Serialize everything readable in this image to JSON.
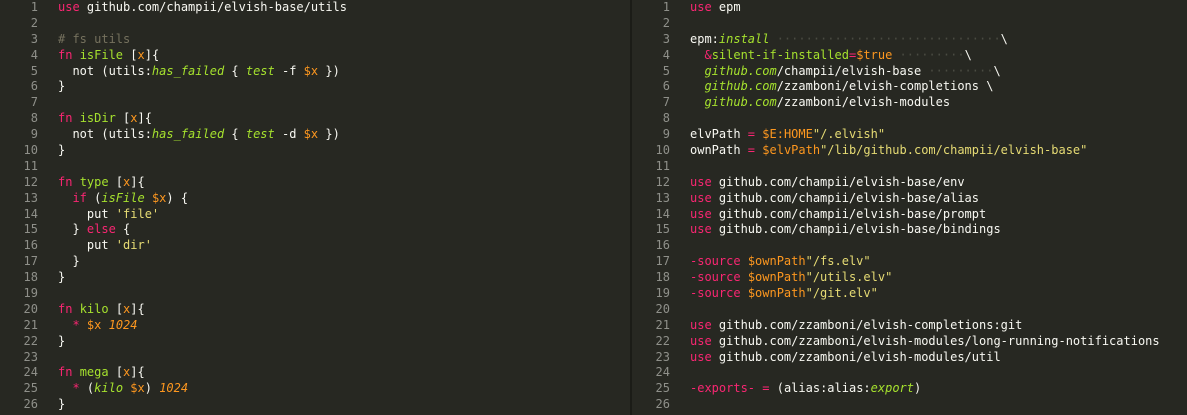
{
  "colors": {
    "background": "#272822",
    "keyword": "#f92672",
    "function": "#a6e22e",
    "parameter": "#fd971f",
    "string": "#e6db74",
    "comment": "#75715e",
    "number": "#ae81ff",
    "plain": "#f8f8f2",
    "line_number": "#8f908a"
  },
  "left_pane": {
    "lines": [
      {
        "n": "1",
        "segs": [
          [
            "kw",
            "use"
          ],
          [
            "pl",
            " github.com/champii/elvish-base/utils"
          ]
        ]
      },
      {
        "n": "2",
        "segs": []
      },
      {
        "n": "3",
        "segs": [
          [
            "cm",
            "# fs utils"
          ]
        ]
      },
      {
        "n": "4",
        "segs": [
          [
            "kw",
            "fn"
          ],
          [
            "pl",
            " "
          ],
          [
            "fn",
            "isFile"
          ],
          [
            "pl",
            " ["
          ],
          [
            "or",
            "x"
          ],
          [
            "pl",
            "]{"
          ]
        ]
      },
      {
        "n": "5",
        "segs": [
          [
            "pl",
            "  not (utils:"
          ],
          [
            "fn ital",
            "has_failed"
          ],
          [
            "pl",
            " { "
          ],
          [
            "fn ital",
            "test"
          ],
          [
            "pl",
            " -f "
          ],
          [
            "or",
            "$x"
          ],
          [
            "pl",
            " })"
          ]
        ]
      },
      {
        "n": "6",
        "segs": [
          [
            "pl",
            "}"
          ]
        ]
      },
      {
        "n": "7",
        "segs": []
      },
      {
        "n": "8",
        "segs": [
          [
            "kw",
            "fn"
          ],
          [
            "pl",
            " "
          ],
          [
            "fn",
            "isDir"
          ],
          [
            "pl",
            " ["
          ],
          [
            "or",
            "x"
          ],
          [
            "pl",
            "]{"
          ]
        ]
      },
      {
        "n": "9",
        "segs": [
          [
            "pl",
            "  not (utils:"
          ],
          [
            "fn ital",
            "has_failed"
          ],
          [
            "pl",
            " { "
          ],
          [
            "fn ital",
            "test"
          ],
          [
            "pl",
            " -d "
          ],
          [
            "or",
            "$x"
          ],
          [
            "pl",
            " })"
          ]
        ]
      },
      {
        "n": "10",
        "segs": [
          [
            "pl",
            "}"
          ]
        ]
      },
      {
        "n": "11",
        "segs": []
      },
      {
        "n": "12",
        "segs": [
          [
            "kw",
            "fn"
          ],
          [
            "pl",
            " "
          ],
          [
            "fn",
            "type"
          ],
          [
            "pl",
            " ["
          ],
          [
            "or",
            "x"
          ],
          [
            "pl",
            "]{"
          ]
        ]
      },
      {
        "n": "13",
        "segs": [
          [
            "pl",
            "  "
          ],
          [
            "kw",
            "if"
          ],
          [
            "pl",
            " ("
          ],
          [
            "fn ital",
            "isFile"
          ],
          [
            "pl",
            " "
          ],
          [
            "or",
            "$x"
          ],
          [
            "pl",
            ") {"
          ]
        ]
      },
      {
        "n": "14",
        "segs": [
          [
            "pl",
            "    put "
          ],
          [
            "st",
            "'file'"
          ]
        ]
      },
      {
        "n": "15",
        "segs": [
          [
            "pl",
            "  } "
          ],
          [
            "kw",
            "else"
          ],
          [
            "pl",
            " {"
          ]
        ]
      },
      {
        "n": "16",
        "segs": [
          [
            "pl",
            "    put "
          ],
          [
            "st",
            "'dir'"
          ]
        ]
      },
      {
        "n": "17",
        "segs": [
          [
            "pl",
            "  }"
          ]
        ]
      },
      {
        "n": "18",
        "segs": [
          [
            "pl",
            "}"
          ]
        ]
      },
      {
        "n": "19",
        "segs": []
      },
      {
        "n": "20",
        "segs": [
          [
            "kw",
            "fn"
          ],
          [
            "pl",
            " "
          ],
          [
            "fn",
            "kilo"
          ],
          [
            "pl",
            " ["
          ],
          [
            "or",
            "x"
          ],
          [
            "pl",
            "]{"
          ]
        ]
      },
      {
        "n": "21",
        "segs": [
          [
            "pl",
            "  "
          ],
          [
            "kw",
            "*"
          ],
          [
            "pl",
            " "
          ],
          [
            "or",
            "$x"
          ],
          [
            "pl",
            " "
          ],
          [
            "or ital",
            "1024"
          ]
        ]
      },
      {
        "n": "22",
        "segs": [
          [
            "pl",
            "}"
          ]
        ]
      },
      {
        "n": "23",
        "segs": []
      },
      {
        "n": "24",
        "segs": [
          [
            "kw",
            "fn"
          ],
          [
            "pl",
            " "
          ],
          [
            "fn",
            "mega"
          ],
          [
            "pl",
            " ["
          ],
          [
            "or",
            "x"
          ],
          [
            "pl",
            "]{"
          ]
        ]
      },
      {
        "n": "25",
        "segs": [
          [
            "pl",
            "  "
          ],
          [
            "kw",
            "*"
          ],
          [
            "pl",
            " ("
          ],
          [
            "fn ital",
            "kilo"
          ],
          [
            "pl",
            " "
          ],
          [
            "or",
            "$x"
          ],
          [
            "pl",
            ") "
          ],
          [
            "or ital",
            "1024"
          ]
        ]
      },
      {
        "n": "26",
        "segs": [
          [
            "pl",
            "}"
          ]
        ]
      }
    ]
  },
  "right_pane": {
    "lines": [
      {
        "n": "1",
        "segs": [
          [
            "kw",
            "use"
          ],
          [
            "pl",
            " epm"
          ]
        ]
      },
      {
        "n": "2",
        "segs": []
      },
      {
        "n": "3",
        "segs": [
          [
            "pl",
            "epm:"
          ],
          [
            "fn ital",
            "install"
          ],
          [
            "ws",
            " ·······························"
          ],
          [
            "pl",
            "\\"
          ]
        ]
      },
      {
        "n": "4",
        "segs": [
          [
            "pl",
            "  "
          ],
          [
            "kw",
            "&"
          ],
          [
            "fn",
            "silent-if-installed"
          ],
          [
            "kw",
            "="
          ],
          [
            "or",
            "$true"
          ],
          [
            "ws",
            " ·········"
          ],
          [
            "pl",
            "\\"
          ]
        ]
      },
      {
        "n": "5",
        "segs": [
          [
            "pl",
            "  "
          ],
          [
            "fn ital",
            "github.com"
          ],
          [
            "pl",
            "/champii/elvish-base"
          ],
          [
            "ws",
            " ·········"
          ],
          [
            "pl",
            "\\"
          ]
        ]
      },
      {
        "n": "6",
        "segs": [
          [
            "pl",
            "  "
          ],
          [
            "fn ital",
            "github.com"
          ],
          [
            "pl",
            "/zzamboni/elvish-completions "
          ],
          [
            "pl",
            "\\"
          ]
        ]
      },
      {
        "n": "7",
        "segs": [
          [
            "pl",
            "  "
          ],
          [
            "fn ital",
            "github.com"
          ],
          [
            "pl",
            "/zzamboni/elvish-modules"
          ]
        ]
      },
      {
        "n": "8",
        "segs": []
      },
      {
        "n": "9",
        "segs": [
          [
            "pl",
            "elvPath "
          ],
          [
            "kw",
            "="
          ],
          [
            "pl",
            " "
          ],
          [
            "or",
            "$E:HOME"
          ],
          [
            "st",
            "\"/.elvish\""
          ]
        ]
      },
      {
        "n": "10",
        "segs": [
          [
            "pl",
            "ownPath "
          ],
          [
            "kw",
            "="
          ],
          [
            "pl",
            " "
          ],
          [
            "or",
            "$elvPath"
          ],
          [
            "st",
            "\"/lib/github.com/champii/elvish-base\""
          ]
        ]
      },
      {
        "n": "11",
        "segs": []
      },
      {
        "n": "12",
        "segs": [
          [
            "kw",
            "use"
          ],
          [
            "pl",
            " github.com/champii/elvish-base/env"
          ]
        ]
      },
      {
        "n": "13",
        "segs": [
          [
            "kw",
            "use"
          ],
          [
            "pl",
            " github.com/champii/elvish-base/alias"
          ]
        ]
      },
      {
        "n": "14",
        "segs": [
          [
            "kw",
            "use"
          ],
          [
            "pl",
            " github.com/champii/elvish-base/prompt"
          ]
        ]
      },
      {
        "n": "15",
        "segs": [
          [
            "kw",
            "use"
          ],
          [
            "pl",
            " github.com/champii/elvish-base/bindings"
          ]
        ]
      },
      {
        "n": "16",
        "segs": []
      },
      {
        "n": "17",
        "segs": [
          [
            "kw",
            "-source"
          ],
          [
            "pl",
            " "
          ],
          [
            "or",
            "$ownPath"
          ],
          [
            "st",
            "\"/fs.elv\""
          ]
        ]
      },
      {
        "n": "18",
        "segs": [
          [
            "kw",
            "-source"
          ],
          [
            "pl",
            " "
          ],
          [
            "or",
            "$ownPath"
          ],
          [
            "st",
            "\"/utils.elv\""
          ]
        ]
      },
      {
        "n": "19",
        "segs": [
          [
            "kw",
            "-source"
          ],
          [
            "pl",
            " "
          ],
          [
            "or",
            "$ownPath"
          ],
          [
            "st",
            "\"/git.elv\""
          ]
        ]
      },
      {
        "n": "20",
        "segs": []
      },
      {
        "n": "21",
        "segs": [
          [
            "kw",
            "use"
          ],
          [
            "pl",
            " github.com/zzamboni/elvish-completions:git"
          ]
        ]
      },
      {
        "n": "22",
        "segs": [
          [
            "kw",
            "use"
          ],
          [
            "pl",
            " github.com/zzamboni/elvish-modules/long-running-notifications"
          ]
        ]
      },
      {
        "n": "23",
        "segs": [
          [
            "kw",
            "use"
          ],
          [
            "pl",
            " github.com/zzamboni/elvish-modules/util"
          ]
        ]
      },
      {
        "n": "24",
        "segs": []
      },
      {
        "n": "25",
        "segs": [
          [
            "kw",
            "-exports-"
          ],
          [
            "pl",
            " "
          ],
          [
            "kw",
            "="
          ],
          [
            "pl",
            " (alias:alias:"
          ],
          [
            "fn ital",
            "export"
          ],
          [
            "pl",
            ")"
          ]
        ]
      },
      {
        "n": "26",
        "segs": [],
        "highlight": true
      }
    ]
  }
}
